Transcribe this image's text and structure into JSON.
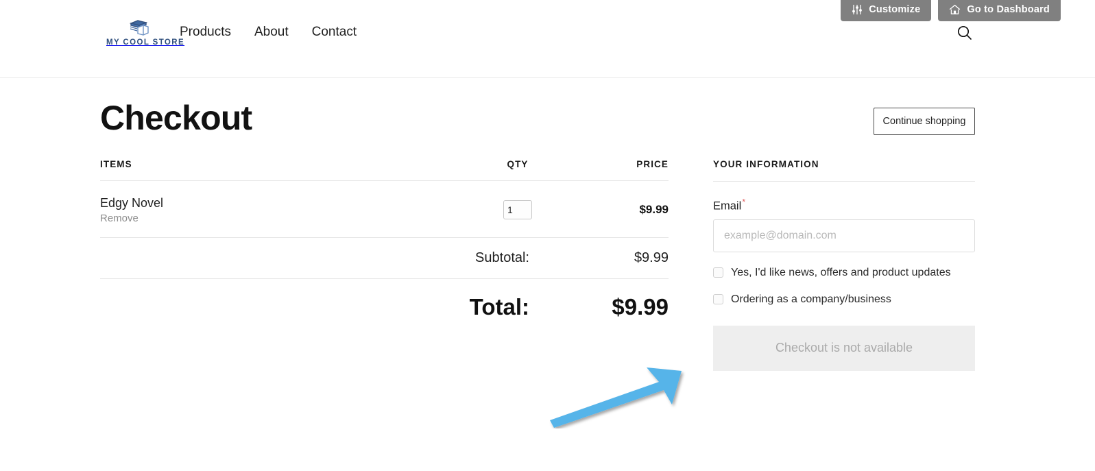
{
  "admin_bar": {
    "buttons": [
      {
        "label": "Customize",
        "icon": "sliders-icon"
      },
      {
        "label": "Go to Dashboard",
        "icon": "home-icon"
      }
    ],
    "background_color": "#808080",
    "text_color": "#ffffff"
  },
  "header": {
    "brand": {
      "name": "MY COOL STORE",
      "logo_icon": "stacked-books-icon",
      "color": "#2f4f7d"
    },
    "nav": [
      {
        "label": "Products"
      },
      {
        "label": "About"
      },
      {
        "label": "Contact"
      }
    ],
    "search_icon": "search-icon"
  },
  "page": {
    "title": "Checkout",
    "continue_shopping_label": "Continue shopping"
  },
  "cart": {
    "columns": {
      "items": "Items",
      "qty": "QTY",
      "price": "Price"
    },
    "rows": [
      {
        "name": "Edgy Novel",
        "remove_label": "Remove",
        "qty": "1",
        "price": "$9.99"
      }
    ],
    "subtotal": {
      "label": "Subtotal:",
      "value": "$9.99"
    },
    "total": {
      "label": "Total:",
      "value": "$9.99"
    }
  },
  "info": {
    "heading": "Your Information",
    "email": {
      "label": "Email",
      "required_mark": "*",
      "value": "",
      "placeholder": "example@domain.com"
    },
    "checkboxes": [
      {
        "label": "Yes, I'd like news, offers and product updates",
        "checked": false
      },
      {
        "label": "Ordering as a company/business",
        "checked": false
      }
    ],
    "checkout_button": {
      "label": "Checkout is not available",
      "disabled": true
    }
  },
  "annotation": {
    "type": "arrow",
    "color": "#56b4e9",
    "direction": "up-right",
    "points_to": "checkout-button"
  }
}
